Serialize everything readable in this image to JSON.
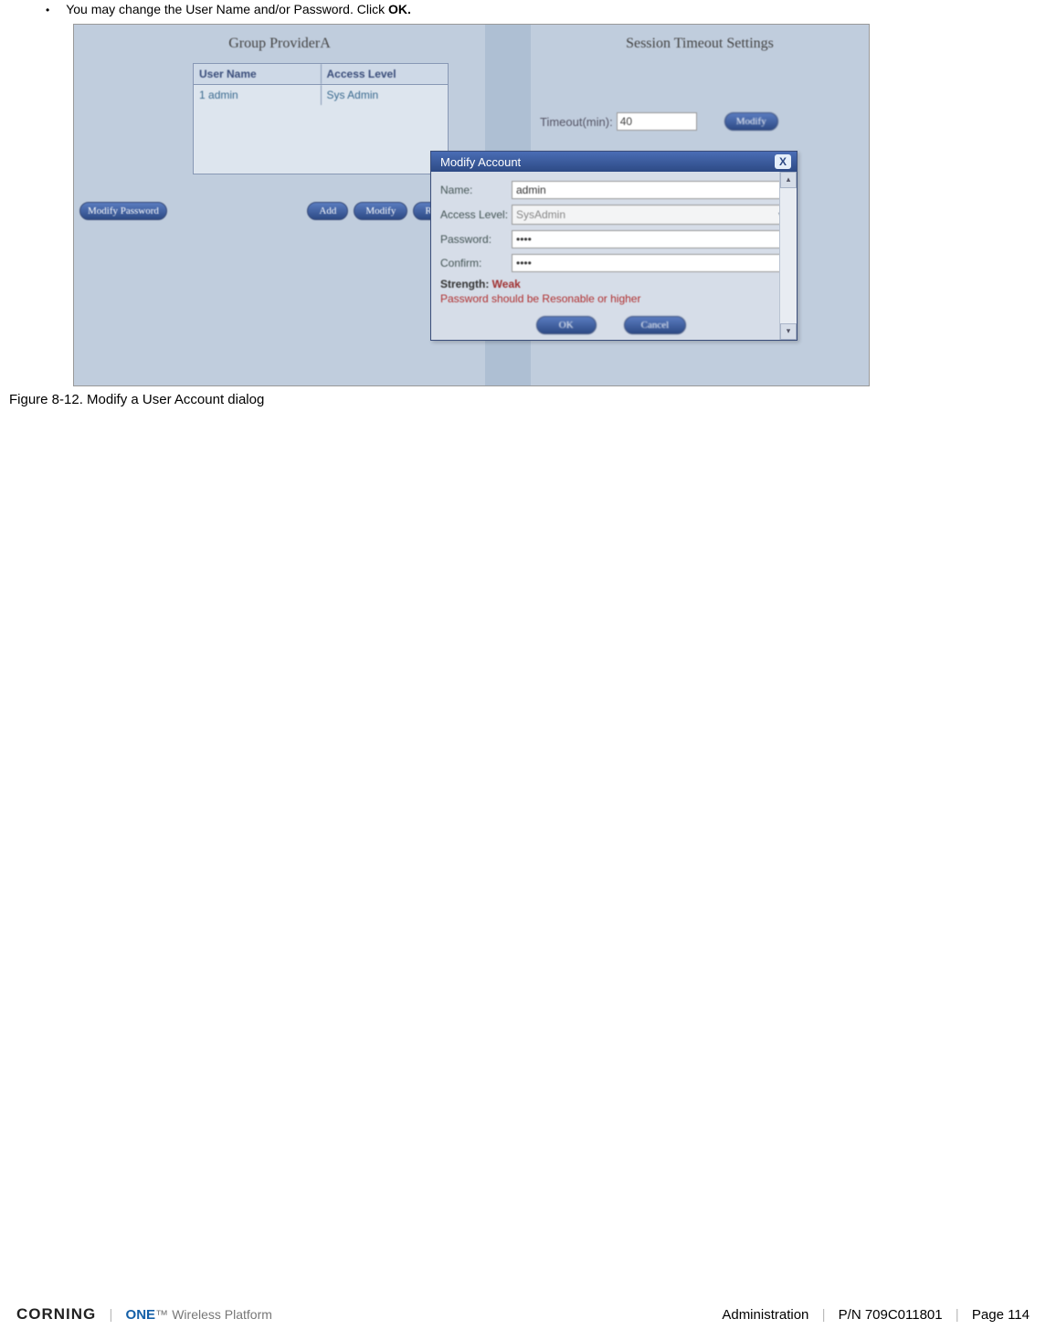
{
  "bullet": {
    "text_pre": "You may change the User Name and/or Password. Click ",
    "text_bold": "OK."
  },
  "groupPanel": {
    "title": "Group ProviderA",
    "headers": [
      "User Name",
      "Access Level"
    ],
    "row": {
      "idx": "1",
      "user": "admin",
      "level": "Sys Admin"
    },
    "buttons": {
      "modifyPassword": "Modify Password",
      "add": "Add",
      "modify": "Modify",
      "remove": "Remove"
    }
  },
  "sessionPanel": {
    "title": "Session Timeout Settings",
    "timeoutLabel": "Timeout(min):",
    "timeoutValue": "40",
    "modifyBtn": "Modify"
  },
  "dialog": {
    "title": "Modify Account",
    "nameLabel": "Name:",
    "nameValue": "admin",
    "accessLabel": "Access Level:",
    "accessValue": "SysAdmin",
    "passwordLabel": "Password:",
    "passwordValue": "••••",
    "confirmLabel": "Confirm:",
    "confirmValue": "••••",
    "strengthLabel": "Strength:",
    "strengthValue": "Weak",
    "warningText": "Password should be Resonable or higher",
    "okBtn": "OK",
    "cancelBtn": "Cancel"
  },
  "caption": "Figure 8-12. Modify a User Account dialog",
  "footer": {
    "brand1": "CORNING",
    "brand2": "ONE",
    "brand3": "Wireless Platform",
    "section": "Administration",
    "part": "P/N 709C011801",
    "page": "Page 114"
  }
}
